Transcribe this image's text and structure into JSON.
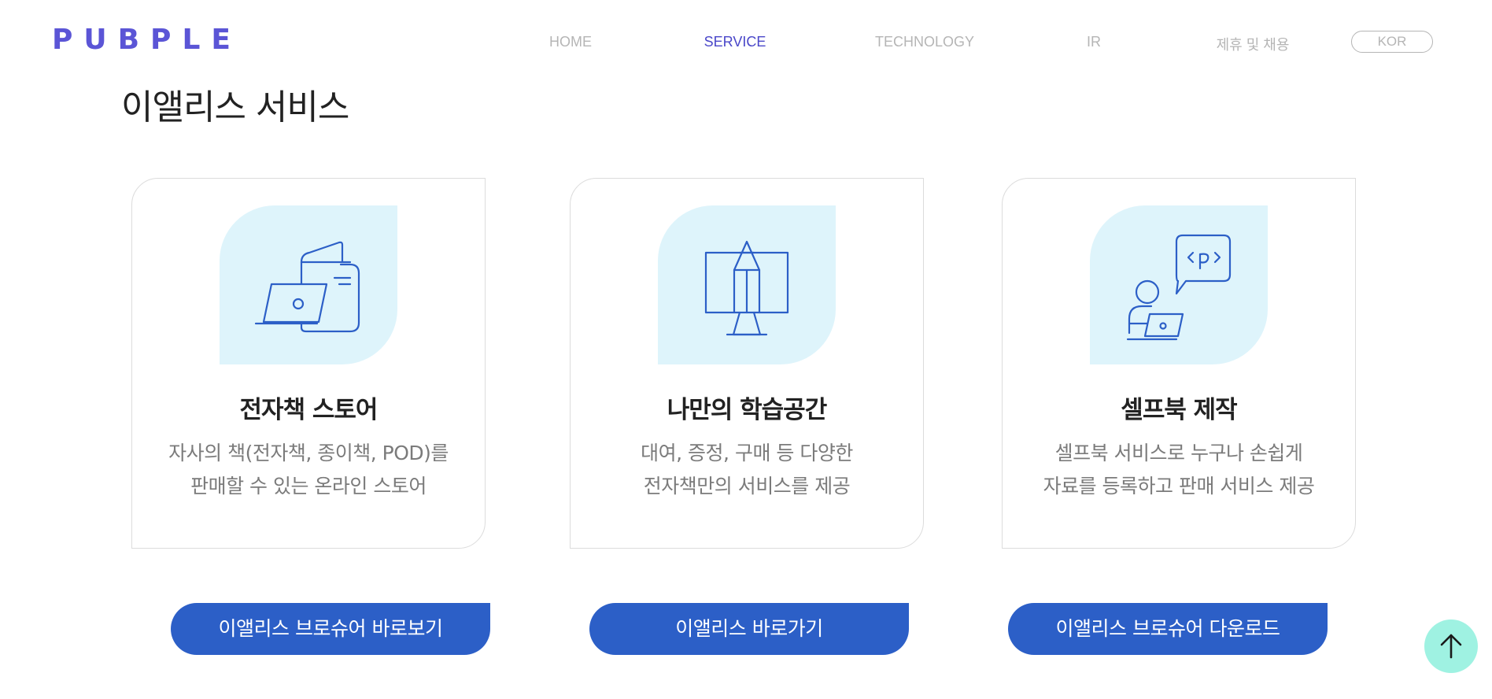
{
  "header": {
    "logo": "PUBPLE",
    "nav": [
      {
        "label": "HOME",
        "active": false
      },
      {
        "label": "SERVICE",
        "active": true
      },
      {
        "label": "TECHNOLOGY",
        "active": false
      },
      {
        "label": "IR",
        "active": false
      },
      {
        "label": "제휴 및 채용",
        "active": false
      }
    ],
    "language": "KOR"
  },
  "main": {
    "title": "이앨리스 서비스",
    "cards": [
      {
        "icon": "ebook-laptop-icon",
        "title": "전자책 스토어",
        "desc_line1": "자사의 책(전자책, 종이책, POD)를",
        "desc_line2": "판매할 수 있는 온라인 스토어"
      },
      {
        "icon": "pencil-monitor-icon",
        "title": "나만의 학습공간",
        "desc_line1": "대여, 증정, 구매 등 다양한",
        "desc_line2": "전자책만의 서비스를 제공"
      },
      {
        "icon": "person-laptop-code-icon",
        "title": "셀프북 제작",
        "desc_line1": "셀프북 서비스로 누구나 손쉽게",
        "desc_line2": "자료를 등록하고 판매 서비스 제공"
      }
    ],
    "buttons": [
      "이앨리스 브로슈어 바로보기",
      "이앨리스 바로가기",
      "이앨리스 브로슈어 다운로드"
    ]
  },
  "scroll_top": {
    "icon": "arrow-up-icon"
  },
  "colors": {
    "brand": "#5b55d6",
    "nav_active": "#4a47c9",
    "button": "#2c5fc7",
    "icon_bg": "#def4fb",
    "icon_stroke": "#2c5fc7",
    "top_button": "#9ff2e2"
  }
}
